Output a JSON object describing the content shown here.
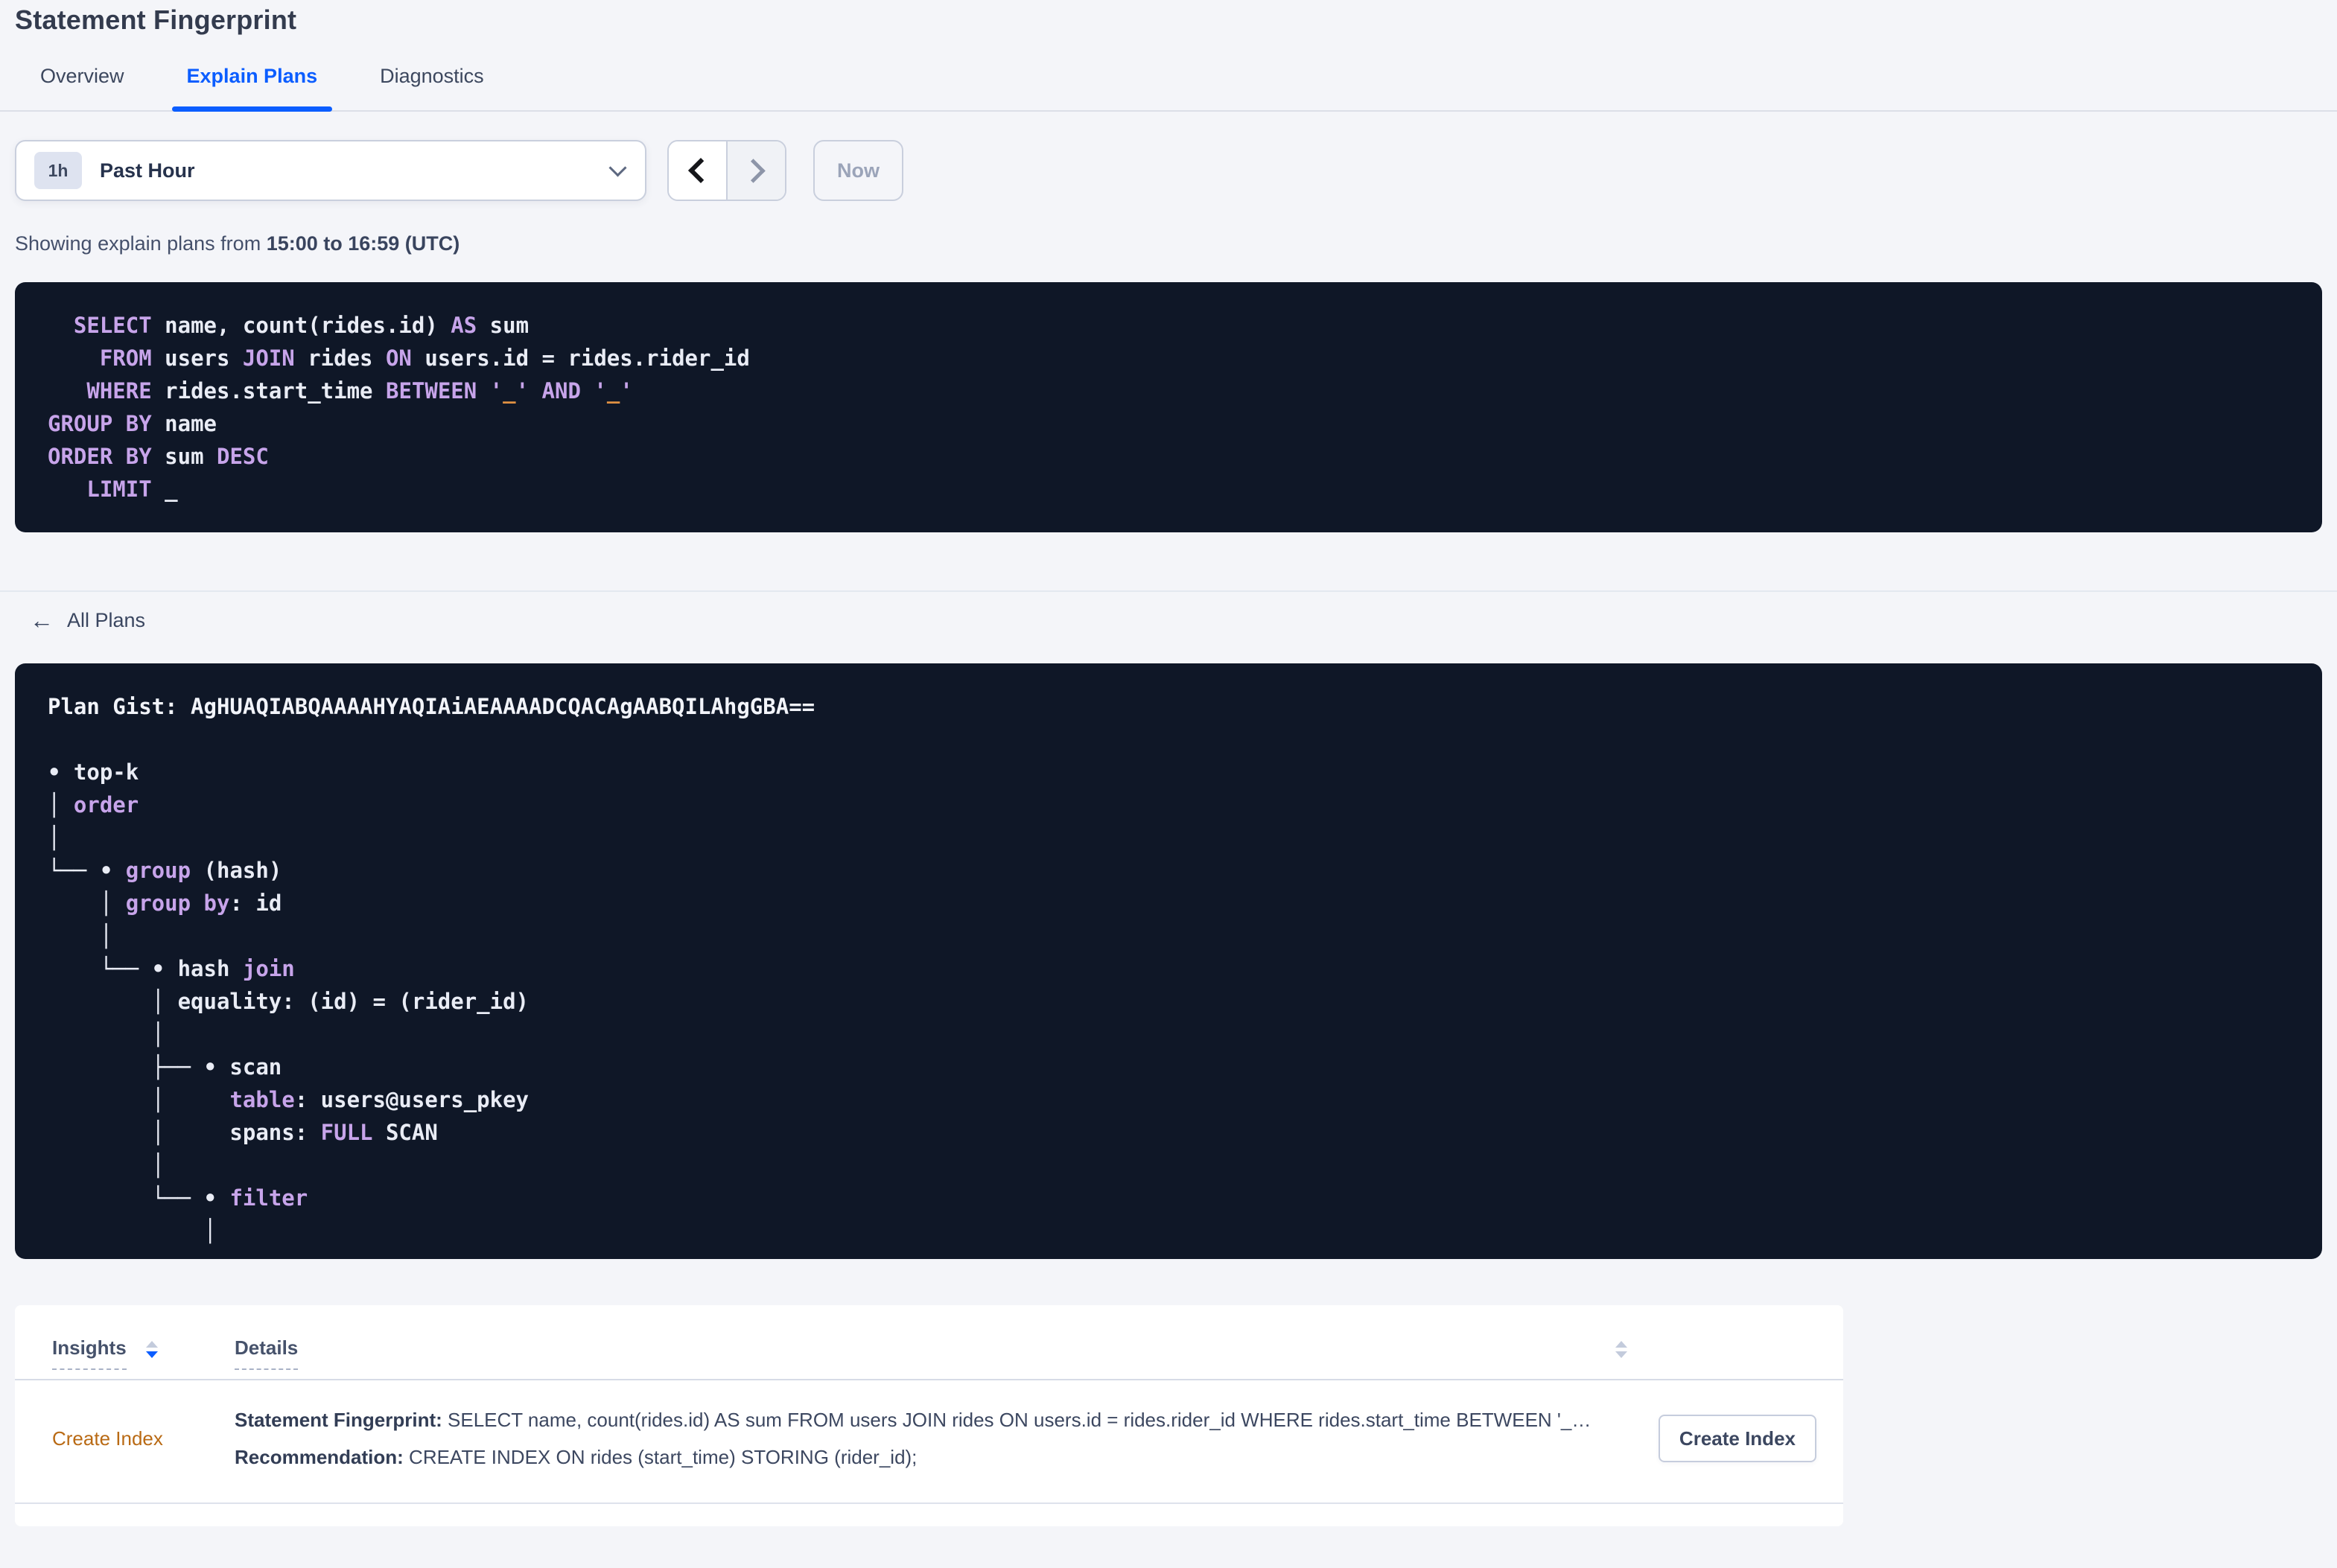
{
  "page": {
    "title": "Statement Fingerprint"
  },
  "tabs": [
    {
      "label": "Overview",
      "active": false
    },
    {
      "label": "Explain Plans",
      "active": true
    },
    {
      "label": "Diagnostics",
      "active": false
    }
  ],
  "time_picker": {
    "badge": "1h",
    "label": "Past Hour",
    "now_label": "Now",
    "prev_icon": "chevron-left",
    "next_icon": "chevron-right",
    "dropdown_icon": "chevron-down"
  },
  "summary": {
    "prefix": "Showing explain plans from ",
    "range": "15:00 to 16:59 (UTC)"
  },
  "sql": {
    "lines": [
      [
        [
          "t",
          "  "
        ],
        [
          "k",
          "SELECT"
        ],
        [
          "t",
          " name, count(rides.id) "
        ],
        [
          "k",
          "AS"
        ],
        [
          "t",
          " sum"
        ]
      ],
      [
        [
          "t",
          "    "
        ],
        [
          "k",
          "FROM"
        ],
        [
          "t",
          " users "
        ],
        [
          "k",
          "JOIN"
        ],
        [
          "t",
          " rides "
        ],
        [
          "k",
          "ON"
        ],
        [
          "t",
          " users.id = rides.rider_id"
        ]
      ],
      [
        [
          "t",
          "   "
        ],
        [
          "k",
          "WHERE"
        ],
        [
          "t",
          " rides.start_time "
        ],
        [
          "k",
          "BETWEEN"
        ],
        [
          "t",
          " "
        ],
        [
          "k",
          "'"
        ],
        [
          "o",
          "_"
        ],
        [
          "k",
          "'"
        ],
        [
          "t",
          " "
        ],
        [
          "k",
          "AND"
        ],
        [
          "t",
          " "
        ],
        [
          "k",
          "'"
        ],
        [
          "o",
          "_"
        ],
        [
          "k",
          "'"
        ]
      ],
      [
        [
          "k",
          "GROUP BY"
        ],
        [
          "t",
          " name"
        ]
      ],
      [
        [
          "k",
          "ORDER BY"
        ],
        [
          "t",
          " sum "
        ],
        [
          "k",
          "DESC"
        ]
      ],
      [
        [
          "t",
          "   "
        ],
        [
          "k",
          "LIMIT"
        ],
        [
          "t",
          " _"
        ]
      ]
    ]
  },
  "back_link": {
    "icon": "←",
    "label": "All Plans"
  },
  "plan": {
    "lines": [
      [
        [
          "b",
          "Plan Gist: AgHUAQIABQAAAAHYAQIAiAEAAAADCQACAgAABQILAhgGBA=="
        ]
      ],
      [],
      [
        [
          "t",
          "• top-k"
        ]
      ],
      [
        [
          "t",
          "│ "
        ],
        [
          "k",
          "order"
        ]
      ],
      [
        [
          "t",
          "│"
        ]
      ],
      [
        [
          "t",
          "└── • "
        ],
        [
          "k",
          "group"
        ],
        [
          "t",
          " (hash)"
        ]
      ],
      [
        [
          "t",
          "    │ "
        ],
        [
          "k",
          "group by"
        ],
        [
          "t",
          ": id"
        ]
      ],
      [
        [
          "t",
          "    │"
        ]
      ],
      [
        [
          "t",
          "    └── • hash "
        ],
        [
          "k",
          "join"
        ]
      ],
      [
        [
          "t",
          "        │ equality: (id) = (rider_id)"
        ]
      ],
      [
        [
          "t",
          "        │"
        ]
      ],
      [
        [
          "t",
          "        ├── • scan"
        ]
      ],
      [
        [
          "t",
          "        │     "
        ],
        [
          "k",
          "table"
        ],
        [
          "t",
          ": users@users_pkey"
        ]
      ],
      [
        [
          "t",
          "        │     spans: "
        ],
        [
          "k",
          "FULL"
        ],
        [
          "t",
          " SCAN"
        ]
      ],
      [
        [
          "t",
          "        │"
        ]
      ],
      [
        [
          "t",
          "        └── • "
        ],
        [
          "k",
          "filter"
        ]
      ],
      [
        [
          "t",
          "            │"
        ]
      ]
    ]
  },
  "insights_table": {
    "columns": [
      {
        "label": "Insights",
        "sort": "desc"
      },
      {
        "label": "Details",
        "sort": "none"
      }
    ],
    "rows": [
      {
        "insight": "Create Index",
        "fingerprint_label": "Statement Fingerprint:",
        "fingerprint_text": " SELECT name, count(rides.id) AS sum FROM users JOIN rides ON users.id = rides.rider_id WHERE rides.start_time BETWEEN '_…",
        "recommendation_label": "Recommendation:",
        "recommendation_text": " CREATE INDEX ON rides (start_time) STORING (rider_id);",
        "action_label": "Create Index"
      }
    ]
  },
  "colors": {
    "accent": "#0b5dff",
    "code_bg": "#0f1727",
    "code_keyword": "#c7a4ea",
    "code_text": "#e9ecf5",
    "code_placeholder": "#e09142",
    "insight_link": "#b96a14"
  }
}
